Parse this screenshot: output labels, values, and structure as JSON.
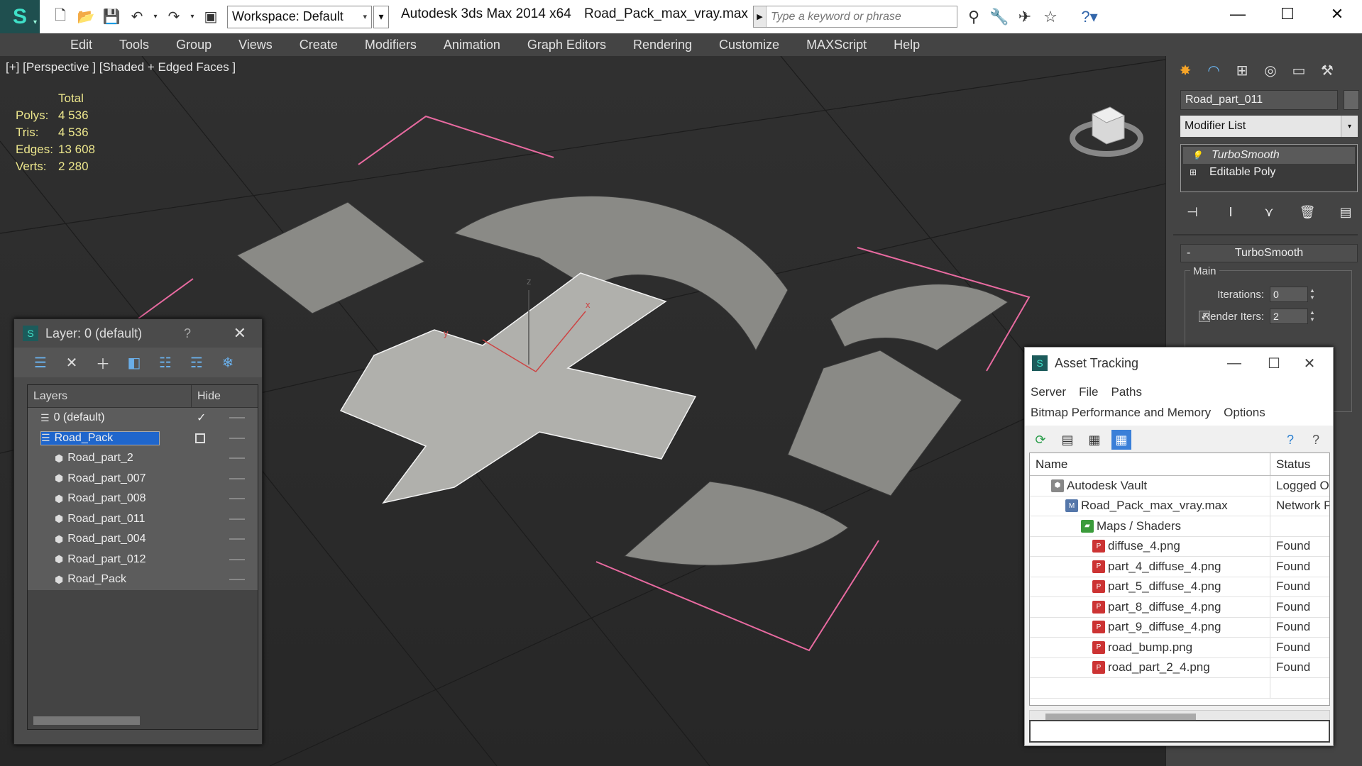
{
  "title_bar": {
    "workspace": "Workspace: Default",
    "app_title": "Autodesk 3ds Max  2014 x64",
    "document": "Road_Pack_max_vray.max",
    "search_placeholder": "Type a keyword or phrase"
  },
  "menu": [
    "Edit",
    "Tools",
    "Group",
    "Views",
    "Create",
    "Modifiers",
    "Animation",
    "Graph Editors",
    "Rendering",
    "Customize",
    "MAXScript",
    "Help"
  ],
  "viewport": {
    "label": "[+] [Perspective ] [Shaded + Edged Faces ]",
    "stats_header": "Total",
    "stats": [
      {
        "k": "Polys:",
        "v": "4 536"
      },
      {
        "k": "Tris:",
        "v": "4 536"
      },
      {
        "k": "Edges:",
        "v": "13 608"
      },
      {
        "k": "Verts:",
        "v": "2 280"
      }
    ],
    "axis_labels": {
      "x": "x",
      "y": "y",
      "z": "z"
    }
  },
  "command_panel": {
    "object_name": "Road_part_011",
    "modifier_list": "Modifier List",
    "stack": [
      "TurboSmooth",
      "Editable Poly"
    ],
    "rollout": "TurboSmooth",
    "group": "Main",
    "iterations_label": "Iterations:",
    "iterations": "0",
    "render_iters_label": "Render Iters:",
    "render_iters": "2"
  },
  "layer_dialog": {
    "title": "Layer: 0 (default)",
    "help": "?",
    "col_layers": "Layers",
    "col_hide": "Hide",
    "rows": [
      {
        "name": "0 (default)",
        "indent": 1
      },
      {
        "name": "Road_Pack",
        "indent": 1,
        "selected": true
      },
      {
        "name": "Road_part_2",
        "indent": 2
      },
      {
        "name": "Road_part_007",
        "indent": 2
      },
      {
        "name": "Road_part_008",
        "indent": 2
      },
      {
        "name": "Road_part_011",
        "indent": 2
      },
      {
        "name": "Road_part_004",
        "indent": 2
      },
      {
        "name": "Road_part_012",
        "indent": 2
      },
      {
        "name": "Road_Pack",
        "indent": 2
      }
    ]
  },
  "asset_dialog": {
    "title": "Asset Tracking",
    "menu1": [
      "Server",
      "File",
      "Paths"
    ],
    "menu2": [
      "Bitmap Performance and Memory",
      "Options"
    ],
    "col_name": "Name",
    "col_status": "Status",
    "rows": [
      {
        "name": "Autodesk Vault",
        "status": "Logged O",
        "indent": 30,
        "icon": "vault"
      },
      {
        "name": "Road_Pack_max_vray.max",
        "status": "Network P",
        "indent": 50,
        "icon": "max"
      },
      {
        "name": "Maps / Shaders",
        "status": "",
        "indent": 72,
        "icon": "folder"
      },
      {
        "name": "diffuse_4.png",
        "status": "Found",
        "indent": 88,
        "icon": "png"
      },
      {
        "name": "part_4_diffuse_4.png",
        "status": "Found",
        "indent": 88,
        "icon": "png"
      },
      {
        "name": "part_5_diffuse_4.png",
        "status": "Found",
        "indent": 88,
        "icon": "png"
      },
      {
        "name": "part_8_diffuse_4.png",
        "status": "Found",
        "indent": 88,
        "icon": "png"
      },
      {
        "name": "part_9_diffuse_4.png",
        "status": "Found",
        "indent": 88,
        "icon": "png"
      },
      {
        "name": "road_bump.png",
        "status": "Found",
        "indent": 88,
        "icon": "png"
      },
      {
        "name": "road_part_2_4.png",
        "status": "Found",
        "indent": 88,
        "icon": "png"
      }
    ]
  }
}
